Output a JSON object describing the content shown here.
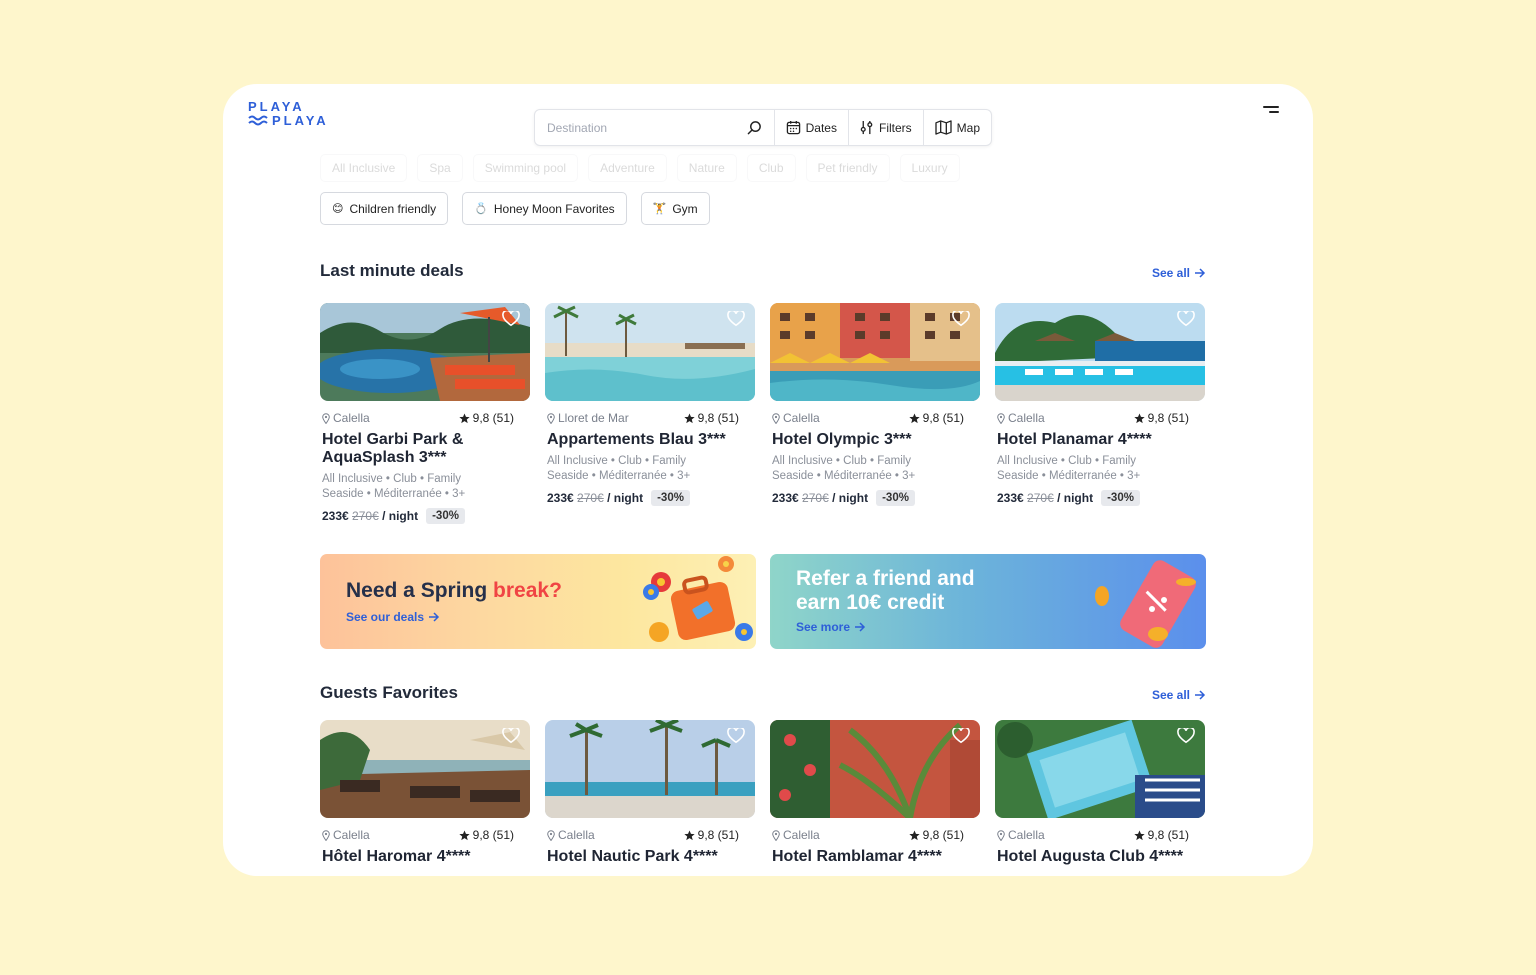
{
  "brand": {
    "line1": "PLAYA",
    "line2": "PLAYA",
    "color": "#2e5fd8"
  },
  "search": {
    "placeholder": "Destination",
    "dates_label": "Dates",
    "filters_label": "Filters",
    "map_label": "Map"
  },
  "faded_tags": [
    "All Inclusive",
    "Spa",
    "Swimming pool",
    "Adventure",
    "Nature",
    "Club",
    "Pet friendly",
    "Luxury"
  ],
  "tags": [
    {
      "emoji": "😊",
      "label": "Children friendly"
    },
    {
      "emoji": "💍",
      "label": "Honey Moon Favorites"
    },
    {
      "emoji": "🏋",
      "label": "Gym"
    }
  ],
  "last_minute": {
    "title": "Last minute deals",
    "see_all": "See all",
    "cards": [
      {
        "location": "Calella",
        "rating": "9,8 (51)",
        "name": "Hotel Garbi Park & AquaSplash 3***",
        "features1": "All Inclusive • Club • Family",
        "features2": "Seaside • Méditerranée • 3+",
        "price": "233€",
        "old_price": "270€",
        "unit": "/ night",
        "discount": "-30%"
      },
      {
        "location": "Lloret de Mar",
        "rating": "9,8 (51)",
        "name": "Appartements Blau 3***",
        "features1": "All Inclusive • Club • Family",
        "features2": "Seaside • Méditerranée • 3+",
        "price": "233€",
        "old_price": "270€",
        "unit": "/ night",
        "discount": "-30%"
      },
      {
        "location": "Calella",
        "rating": "9,8 (51)",
        "name": "Hotel Olympic 3***",
        "features1": "All Inclusive • Club • Family",
        "features2": "Seaside • Méditerranée • 3+",
        "price": "233€",
        "old_price": "270€",
        "unit": "/ night",
        "discount": "-30%"
      },
      {
        "location": "Calella",
        "rating": "9,8 (51)",
        "name": "Hotel Planamar 4****",
        "features1": "All Inclusive • Club • Family",
        "features2": "Seaside • Méditerranée • 3+",
        "price": "233€",
        "old_price": "270€",
        "unit": "/ night",
        "discount": "-30%"
      }
    ]
  },
  "banners": {
    "spring": {
      "title_a": "Need a Spring",
      "title_b": "break?",
      "link": "See our deals"
    },
    "refer": {
      "title_line1": "Refer a friend and",
      "title_line2": "earn 10€ credit",
      "link": "See more"
    }
  },
  "guests": {
    "title": "Guests Favorites",
    "see_all": "See all",
    "cards": [
      {
        "location": "Calella",
        "rating": "9,8 (51)",
        "name": "Hôtel Haromar 4****"
      },
      {
        "location": "Calella",
        "rating": "9,8 (51)",
        "name": "Hotel Nautic Park 4****"
      },
      {
        "location": "Calella",
        "rating": "9,8 (51)",
        "name": "Hotel Ramblamar 4****"
      },
      {
        "location": "Calella",
        "rating": "9,8 (51)",
        "name": "Hotel Augusta Club 4****"
      }
    ]
  },
  "colors": {
    "background": "#fef6cc",
    "accent": "#2e5fd8",
    "highlight": "#f04444"
  },
  "icons": [
    "search-icon",
    "calendar-icon",
    "filters-icon",
    "map-icon",
    "menu-icon",
    "heart-icon",
    "location-pin-icon",
    "star-icon",
    "arrow-right-icon"
  ]
}
